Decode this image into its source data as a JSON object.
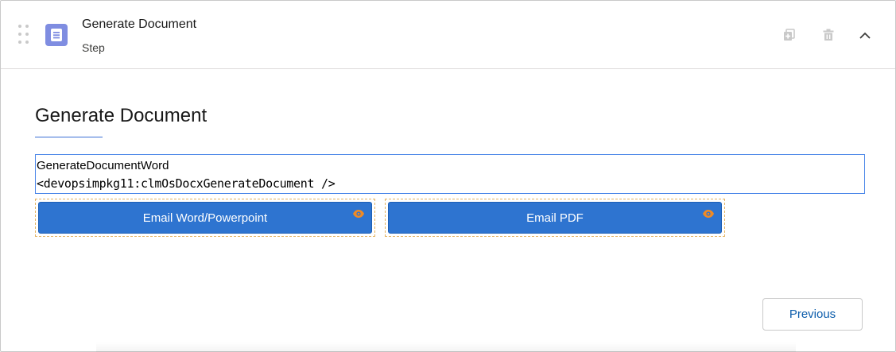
{
  "header": {
    "title": "Generate Document",
    "subtitle": "Step",
    "icons": {
      "drag": "drag-handle-icon",
      "step": "document-icon",
      "clone": "clone-icon",
      "delete": "trash-icon",
      "collapse": "chevron-up-icon"
    },
    "step_icon_color": "#7f8de1"
  },
  "main": {
    "section_title": "Generate Document",
    "code_block": {
      "line1": "GenerateDocumentWord",
      "line2": "<devopsimpkg11:clmOsDocxGenerateDocument />"
    },
    "actions": [
      {
        "label": "Email Word/Powerpoint",
        "icon": "eye-icon"
      },
      {
        "label": "Email PDF",
        "icon": "eye-icon"
      }
    ],
    "previous_label": "Previous"
  },
  "colors": {
    "action_button": "#2e74d0",
    "eye_icon": "#f08a24",
    "accent_link": "#0b5cab",
    "dashed_outline": "#e3b261"
  }
}
